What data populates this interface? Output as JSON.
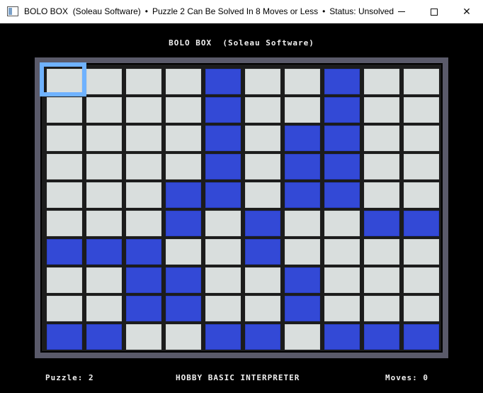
{
  "window": {
    "app_name": "BOLO BOX  (Soleau Software)",
    "puzzle_info": "Puzzle 2 Can Be Solved In 8 Moves or Less",
    "status": "Status: Unsolved",
    "separator": "•"
  },
  "game": {
    "title": "BOLO BOX  (Soleau Software)",
    "grid": [
      [
        0,
        0,
        0,
        0,
        1,
        0,
        0,
        1,
        0,
        0
      ],
      [
        0,
        0,
        0,
        0,
        1,
        0,
        0,
        1,
        0,
        0
      ],
      [
        0,
        0,
        0,
        0,
        1,
        0,
        1,
        1,
        0,
        0
      ],
      [
        0,
        0,
        0,
        0,
        1,
        0,
        1,
        1,
        0,
        0
      ],
      [
        0,
        0,
        0,
        1,
        1,
        0,
        1,
        1,
        0,
        0
      ],
      [
        0,
        0,
        0,
        1,
        0,
        1,
        0,
        0,
        1,
        1
      ],
      [
        1,
        1,
        1,
        0,
        0,
        1,
        0,
        0,
        0,
        0
      ],
      [
        0,
        0,
        1,
        1,
        0,
        0,
        1,
        0,
        0,
        0
      ],
      [
        0,
        0,
        1,
        1,
        0,
        0,
        1,
        0,
        0,
        0
      ],
      [
        1,
        1,
        0,
        0,
        1,
        1,
        0,
        1,
        1,
        1
      ]
    ],
    "selected_cell": {
      "row": 0,
      "col": 0
    },
    "colors": {
      "on": "#3349d6",
      "off": "#d9dedd",
      "cursor": "#6fb2ff"
    }
  },
  "footer": {
    "puzzle_label": "Puzzle: 2",
    "interpreter": "HOBBY BASIC INTERPRETER",
    "moves_label": "Moves: 0"
  }
}
